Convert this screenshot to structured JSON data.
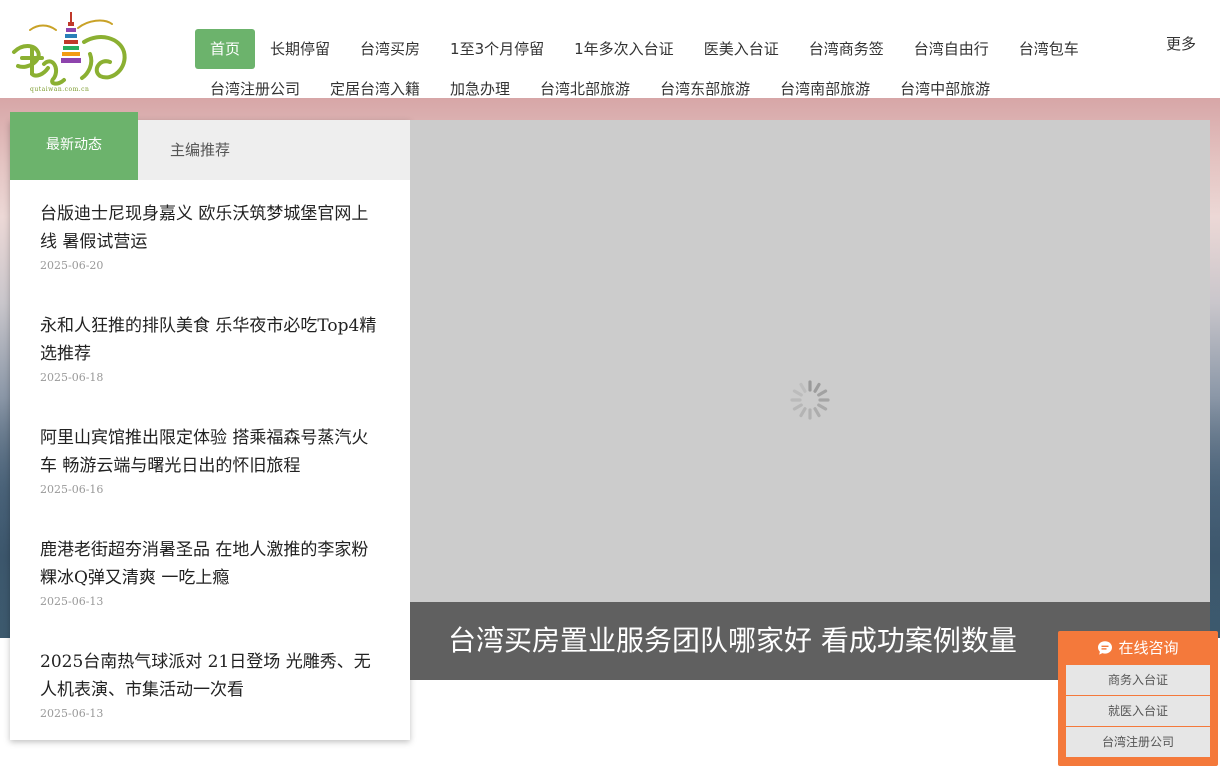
{
  "logo": {
    "subtitle": "qutaiwan.com.cn"
  },
  "nav": {
    "row1": [
      "首页",
      "长期停留",
      "台湾买房",
      "1至3个月停留",
      "1年多次入台证",
      "医美入台证",
      "台湾商务签",
      "台湾自由行",
      "台湾包车"
    ],
    "row2": [
      "台湾注册公司",
      "定居台湾入籍",
      "加急办理",
      "台湾北部旅游",
      "台湾东部旅游",
      "台湾南部旅游",
      "台湾中部旅游"
    ],
    "more": "更多"
  },
  "tabs": {
    "active": "最新动态",
    "other": "主编推荐"
  },
  "news": [
    {
      "title": "台版迪士尼现身嘉义 欧乐沃筑梦城堡官网上线 暑假试营运",
      "date": "2025-06-20"
    },
    {
      "title": "永和人狂推的排队美食 乐华夜市必吃Top4精选推荐",
      "date": "2025-06-18"
    },
    {
      "title": "阿里山宾馆推出限定体验 搭乘福森号蒸汽火车 畅游云端与曙光日出的怀旧旅程",
      "date": "2025-06-16"
    },
    {
      "title": "鹿港老街超夯消暑圣品 在地人激推的李家粉粿冰Q弹又清爽 一吃上瘾",
      "date": "2025-06-13"
    },
    {
      "title": "2025台南热气球派对 21日登场 光雕秀、无人机表演、市集活动一次看",
      "date": "2025-06-13"
    }
  ],
  "slider": {
    "caption": "台湾买房置业服务团队哪家好 看成功案例数量"
  },
  "consult": {
    "title": "在线咨询",
    "buttons": [
      "商务入台证",
      "就医入台证",
      "台湾注册公司"
    ]
  },
  "colors": {
    "accent_green": "#6cb36c",
    "consult_orange": "#f4793b"
  }
}
